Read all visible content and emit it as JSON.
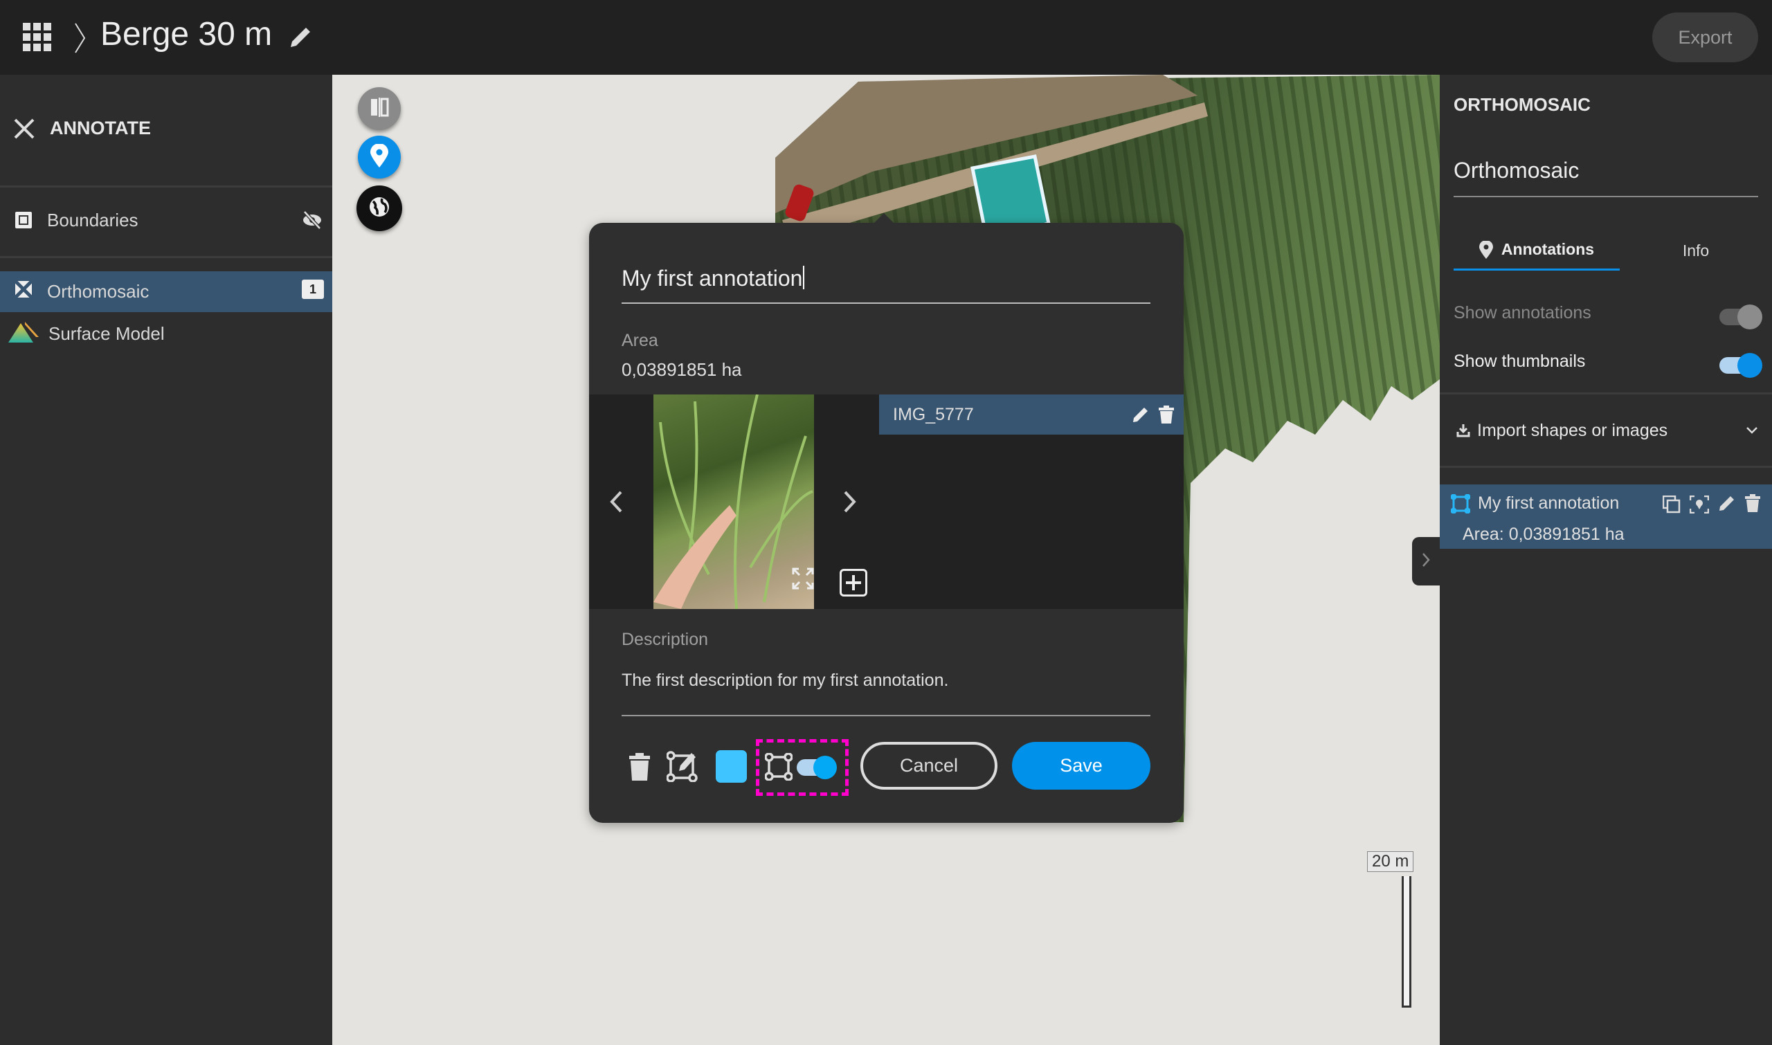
{
  "header": {
    "title": "Berge 30 m",
    "export_label": "Export",
    "icons": [
      "apps-grid-icon",
      "chevron-right-icon",
      "pencil-icon"
    ]
  },
  "left_sidebar": {
    "title": "ANNOTATE",
    "layers": [
      {
        "label": "Boundaries",
        "icon": "boundaries-icon",
        "visibility": "hidden"
      },
      {
        "label": "Orthomosaic",
        "icon": "orthomosaic-icon",
        "badge": "1",
        "selected": true
      },
      {
        "label": "Surface Model",
        "icon": "surface-model-icon"
      }
    ]
  },
  "map": {
    "tools": [
      "compare-icon",
      "location-pin-icon",
      "globe-icon"
    ],
    "scale_label": "20 m"
  },
  "dialog": {
    "title_value": "My first annotation",
    "area_label": "Area",
    "area_value": "0,03891851 ha",
    "image_name": "IMG_5777",
    "description_label": "Description",
    "description_value": "The first description for my first annotation.",
    "color": "#40c4ff",
    "show_shape_toggle": true,
    "cancel_label": "Cancel",
    "save_label": "Save"
  },
  "right_panel": {
    "heading": "ORTHOMOSAIC",
    "name_value": "Orthomosaic",
    "tabs": [
      {
        "label": "Annotations",
        "active": true
      },
      {
        "label": "Info",
        "active": false
      }
    ],
    "show_annotations_label": "Show annotations",
    "show_annotations": true,
    "show_annotations_disabled": true,
    "show_thumbnails_label": "Show thumbnails",
    "show_thumbnails": true,
    "import_label": "Import shapes or images",
    "annotations": [
      {
        "name": "My first annotation",
        "area": "Area: 0,03891851 ha"
      }
    ]
  },
  "colors": {
    "accent": "#0091ea",
    "selected_row": "#375470",
    "header_bg": "#212121",
    "panel_bg": "#2d2d2d",
    "highlight_dash": "#ff00cc"
  }
}
